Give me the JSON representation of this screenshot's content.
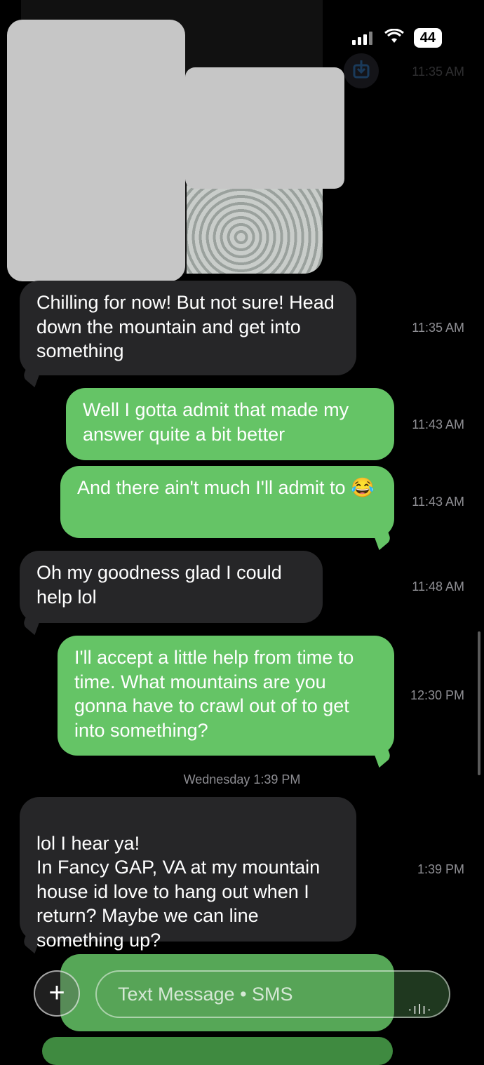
{
  "status_bar": {
    "battery": "44"
  },
  "messages": [
    {
      "dir": "in",
      "text": "Chilling for now! But not sure! Head down the mountain and get into something",
      "time": "11:35 AM"
    },
    {
      "dir": "out",
      "text": "Well I gotta admit that made my answer quite a bit better",
      "time": "11:43 AM"
    },
    {
      "dir": "out",
      "text": "And there ain't much I'll admit to 😂",
      "time": "11:43 AM"
    },
    {
      "dir": "in",
      "text": "Oh my goodness glad I could help lol",
      "time": "11:48 AM"
    },
    {
      "dir": "out",
      "text": "I'll accept a little help from time to time. What mountains are you gonna have to crawl out of to get into something?",
      "time": "12:30 PM"
    },
    {
      "dir": "in",
      "text": "lol I hear ya!\nIn Fancy GAP, VA at my mountain house id love to hang out when I return? Maybe we can line something up?",
      "time": "1:39 PM"
    }
  ],
  "media_time": "11:35 AM",
  "day_separator": "Wednesday 1:39 PM",
  "composer": {
    "placeholder": "Text Message • SMS",
    "add_icon": "plus-icon",
    "audio_icon": "waveform-icon"
  },
  "icons": {
    "save": "save-icon",
    "signal": "signal-icon",
    "wifi": "wifi-icon",
    "battery": "battery-icon"
  },
  "colors": {
    "incoming": "#262628",
    "outgoing": "#65c466",
    "background": "#000000"
  }
}
